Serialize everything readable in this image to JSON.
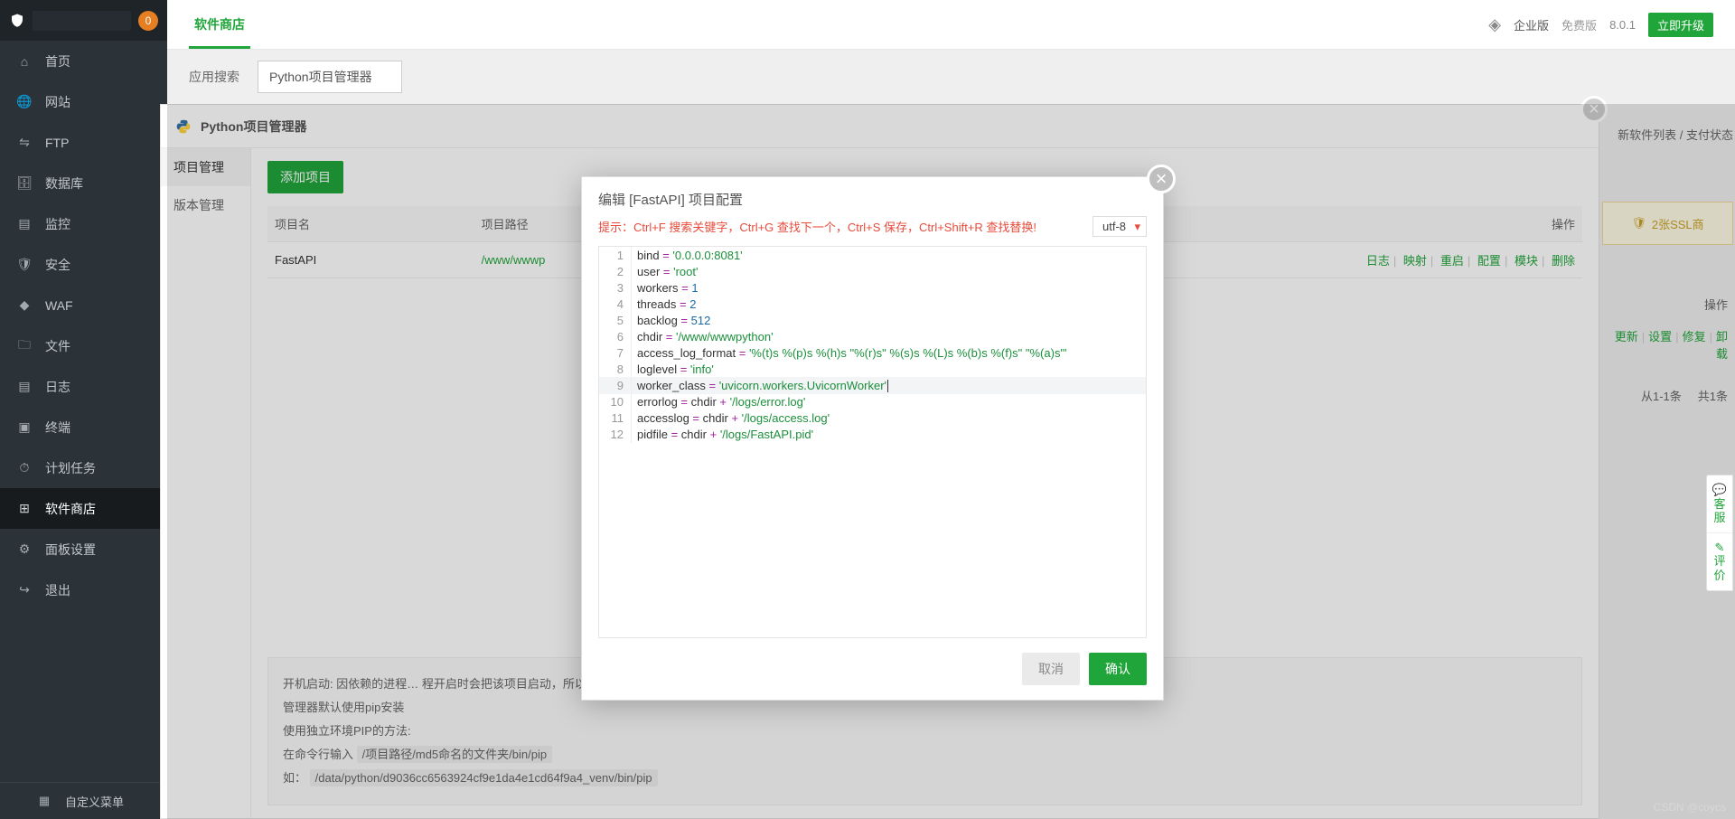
{
  "sidebar": {
    "badge": "0",
    "items": [
      {
        "label": "首页",
        "icon": "home"
      },
      {
        "label": "网站",
        "icon": "globe"
      },
      {
        "label": "FTP",
        "icon": "ftp"
      },
      {
        "label": "数据库",
        "icon": "db"
      },
      {
        "label": "监控",
        "icon": "monitor"
      },
      {
        "label": "安全",
        "icon": "shield"
      },
      {
        "label": "WAF",
        "icon": "waf"
      },
      {
        "label": "文件",
        "icon": "folder"
      },
      {
        "label": "日志",
        "icon": "log"
      },
      {
        "label": "终端",
        "icon": "terminal"
      },
      {
        "label": "计划任务",
        "icon": "cron"
      },
      {
        "label": "软件商店",
        "icon": "store",
        "active": true
      },
      {
        "label": "面板设置",
        "icon": "gear"
      },
      {
        "label": "退出",
        "icon": "exit"
      }
    ],
    "custom_menu": "自定义菜单"
  },
  "topbar": {
    "tab": "软件商店",
    "edition_pro": "企业版",
    "edition_free": "免费版",
    "version": "8.0.1",
    "upgrade": "立即升级"
  },
  "search": {
    "label": "应用搜索",
    "value": "Python项目管理器"
  },
  "panel": {
    "title": "Python项目管理器",
    "tabs": [
      "项目管理",
      "版本管理"
    ],
    "add_button": "添加项目",
    "columns": {
      "name": "项目名",
      "path": "项目路径",
      "ops": "操作"
    },
    "row": {
      "name": "FastAPI",
      "path": "/www/wwwp",
      "ops": [
        "日志",
        "映射",
        "重启",
        "配置",
        "模块",
        "删除"
      ]
    },
    "help": {
      "l1_a": "开机启动: 因依赖的进程",
      "l1_b": "程开启时会把该项目启动，所以需要关闭开机启动请将守护进程也一起关",
      "l2": "管理器默认使用pip安装",
      "l3": "使用独立环境PIP的方法:",
      "l4": "在命令行输入",
      "l4_code": "/项目路径/md5命名的文件夹/bin/pip",
      "l5": "如：",
      "l5_code": "/data/python/d9036cc6563924cf9e1da4e1cd64f9a4_venv/bin/pip"
    }
  },
  "peek": {
    "top_link": "新软件列表 / 支付状态",
    "ssl": "2张SSL商",
    "th": "操作",
    "ops": [
      "更新",
      "设置",
      "修复",
      "卸载"
    ],
    "foot": [
      "从1-1条",
      "共1条"
    ]
  },
  "modal": {
    "title": "编辑 [FastAPI] 项目配置",
    "hint": "提示：Ctrl+F 搜索关键字，Ctrl+G 查找下一个，Ctrl+S 保存，Ctrl+Shift+R 查找替换!",
    "encoding": "utf-8",
    "code": [
      {
        "n": 1,
        "t": [
          [
            "id",
            "bind"
          ],
          [
            "op",
            " = "
          ],
          [
            "str",
            "'0.0.0.0:8081'"
          ]
        ]
      },
      {
        "n": 2,
        "t": [
          [
            "id",
            "user"
          ],
          [
            "op",
            " = "
          ],
          [
            "str",
            "'root'"
          ]
        ]
      },
      {
        "n": 3,
        "t": [
          [
            "id",
            "workers"
          ],
          [
            "op",
            " = "
          ],
          [
            "num",
            "1"
          ]
        ]
      },
      {
        "n": 4,
        "t": [
          [
            "id",
            "threads"
          ],
          [
            "op",
            " = "
          ],
          [
            "num",
            "2"
          ]
        ]
      },
      {
        "n": 5,
        "t": [
          [
            "id",
            "backlog"
          ],
          [
            "op",
            " = "
          ],
          [
            "num",
            "512"
          ]
        ]
      },
      {
        "n": 6,
        "t": [
          [
            "id",
            "chdir"
          ],
          [
            "op",
            " = "
          ],
          [
            "str",
            "'/www/wwwpython'"
          ]
        ]
      },
      {
        "n": 7,
        "t": [
          [
            "id",
            "access_log_format"
          ],
          [
            "op",
            " = "
          ],
          [
            "str",
            "'%(t)s %(p)s %(h)s \"%(r)s\" %(s)s %(L)s %(b)s %(f)s\" \"%(a)s\"'"
          ]
        ]
      },
      {
        "n": 8,
        "t": [
          [
            "id",
            "loglevel"
          ],
          [
            "op",
            " = "
          ],
          [
            "str",
            "'info'"
          ]
        ]
      },
      {
        "n": 9,
        "hl": true,
        "cursor": true,
        "t": [
          [
            "id",
            "worker_class"
          ],
          [
            "op",
            " = "
          ],
          [
            "str",
            "'uvicorn.workers.UvicornWorker'"
          ]
        ]
      },
      {
        "n": 10,
        "t": [
          [
            "id",
            "errorlog"
          ],
          [
            "op",
            " = "
          ],
          [
            "id",
            "chdir"
          ],
          [
            "op",
            " + "
          ],
          [
            "str",
            "'/logs/error.log'"
          ]
        ]
      },
      {
        "n": 11,
        "t": [
          [
            "id",
            "accesslog"
          ],
          [
            "op",
            " = "
          ],
          [
            "id",
            "chdir"
          ],
          [
            "op",
            " + "
          ],
          [
            "str",
            "'/logs/access.log'"
          ]
        ]
      },
      {
        "n": 12,
        "t": [
          [
            "id",
            "pidfile"
          ],
          [
            "op",
            " = "
          ],
          [
            "id",
            "chdir"
          ],
          [
            "op",
            " + "
          ],
          [
            "str",
            "'/logs/FastAPI.pid'"
          ]
        ]
      }
    ],
    "cancel": "取消",
    "ok": "确认"
  },
  "side_float": {
    "a": "客服",
    "b": "评价"
  },
  "watermark": "CSDN @coycs"
}
